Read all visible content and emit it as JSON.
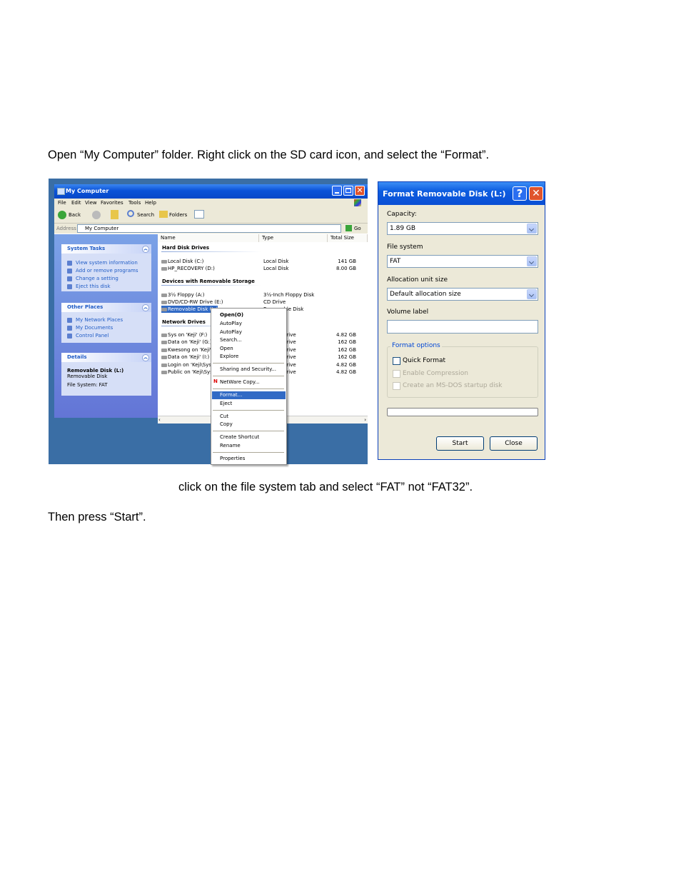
{
  "doc": {
    "para1": "Open “My Computer” folder. Right click on the SD card icon, and select the “Format”.",
    "para2": "click on the file system tab and select “FAT” not “FAT32”.",
    "para3": "Then press “Start”."
  },
  "explorer": {
    "title": "My Computer",
    "menu": [
      "File",
      "Edit",
      "View",
      "Favorites",
      "Tools",
      "Help"
    ],
    "toolbar": {
      "back": "Back",
      "search": "Search",
      "folders": "Folders"
    },
    "address": {
      "label": "Address",
      "value": "My Computer",
      "go": "Go"
    },
    "system_tasks": {
      "title": "System Tasks",
      "items": [
        "View system information",
        "Add or remove programs",
        "Change a setting",
        "Eject this disk"
      ]
    },
    "other_places": {
      "title": "Other Places",
      "items": [
        "My Network Places",
        "My Documents",
        "Control Panel"
      ]
    },
    "details": {
      "title": "Details",
      "name": "Removable Disk (L:)",
      "type": "Removable Disk",
      "fs": "File System: FAT"
    },
    "columns": [
      "Name",
      "Type",
      "Total Size"
    ],
    "groups": {
      "hdd": "Hard Disk Drives",
      "removable": "Devices with Removable Storage",
      "network": "Network Drives"
    },
    "hdd": [
      {
        "name": "Local Disk (C:)",
        "type": "Local Disk",
        "size": "141 GB"
      },
      {
        "name": "HP_RECOVERY (D:)",
        "type": "Local Disk",
        "size": "8.00 GB"
      }
    ],
    "removable": [
      {
        "name": "3½ Floppy (A:)",
        "type": "3½-Inch Floppy Disk",
        "size": ""
      },
      {
        "name": "DVD/CD-RW Drive (E:)",
        "type": "CD Drive",
        "size": ""
      },
      {
        "name": "Removable Disk (L:)",
        "type": "Removable Disk",
        "size": ""
      }
    ],
    "network": [
      {
        "name": "Sys on 'Keji' (F:)",
        "type": "Drive",
        "size": "4.82 GB"
      },
      {
        "name": "Data on 'Keji' (G:)",
        "type": "Drive",
        "size": "162 GB"
      },
      {
        "name": "Kwesong on 'Keji\\",
        "type": "Drive",
        "size": "162 GB"
      },
      {
        "name": "Data on 'Keji' (I:)",
        "type": "Drive",
        "size": "162 GB"
      },
      {
        "name": "Login on 'Keji\\Sys",
        "type": "Drive",
        "size": "4.82 GB"
      },
      {
        "name": "Public on 'Keji\\Sys",
        "type": "Drive",
        "size": "4.82 GB"
      }
    ]
  },
  "context_menu": {
    "items": [
      "Open(O)",
      "AutoPlay",
      "AutoPlay",
      "Search...",
      "Open",
      "Explore",
      "Sharing and Security...",
      "NetWare Copy...",
      "Format...",
      "Eject",
      "Cut",
      "Copy",
      "Create Shortcut",
      "Rename",
      "Properties"
    ],
    "highlighted": "Format..."
  },
  "format_dialog": {
    "title": "Format Removable Disk (L:)",
    "capacity_label": "Capacity:",
    "capacity_value": "1.89 GB",
    "fs_label": "File system",
    "fs_value": "FAT",
    "alloc_label": "Allocation unit size",
    "alloc_value": "Default allocation size",
    "volume_label": "Volume label",
    "volume_value": "",
    "options_label": "Format options",
    "quick_format": "Quick Format",
    "enable_compression": "Enable Compression",
    "msdos": "Create an MS-DOS startup disk",
    "start": "Start",
    "close": "Close"
  }
}
